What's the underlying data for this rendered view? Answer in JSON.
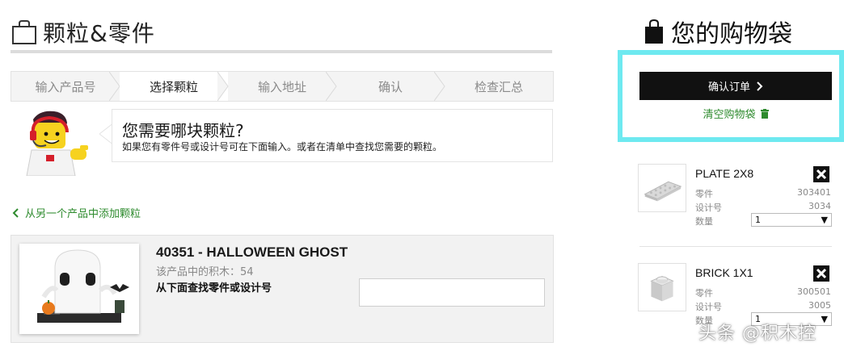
{
  "header": {
    "title": "颗粒&零件"
  },
  "steps": [
    {
      "label": "输入产品号",
      "active": false
    },
    {
      "label": "选择颗粒",
      "active": true
    },
    {
      "label": "输入地址",
      "active": false
    },
    {
      "label": "确认",
      "active": false
    },
    {
      "label": "检查汇总",
      "active": false
    }
  ],
  "helper": {
    "heading": "您需要哪块颗粒?",
    "text": "如果您有零件号或设计号可在下面输入。或者在清单中查找您需要的颗粒。"
  },
  "add_product_link": "从另一个产品中添加颗粒",
  "product": {
    "name": "40351 - HALLOWEEN GHOST",
    "brick_count": "该产品中的积木：54",
    "search_label": "从下面查找零件或设计号",
    "search_value": ""
  },
  "bag": {
    "title": "您的购物袋",
    "confirm_label": "确认订单",
    "clear_label": "清空购物袋",
    "items": [
      {
        "name": "PLATE 2X8",
        "part_label": "零件",
        "part_value": "303401",
        "design_label": "设计号",
        "design_value": "3034",
        "qty_label": "数量",
        "qty_value": "1"
      },
      {
        "name": "BRICK 1X1",
        "part_label": "零件",
        "part_value": "300501",
        "design_label": "设计号",
        "design_value": "3005",
        "qty_label": "数量",
        "qty_value": "1"
      }
    ]
  },
  "watermark": "头条 @积木控",
  "colors": {
    "accent_green": "#2e8b2e",
    "highlight_cyan": "#6ee9f0",
    "button_black": "#111111"
  }
}
